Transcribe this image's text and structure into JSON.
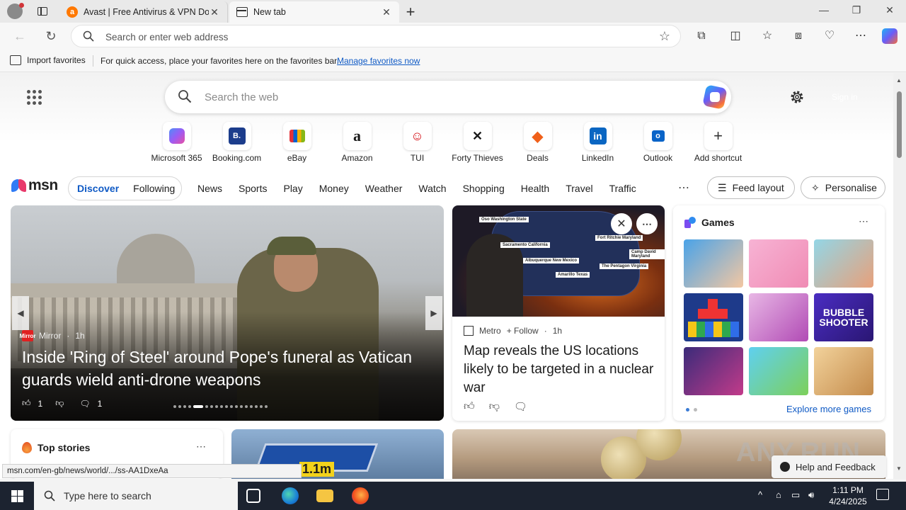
{
  "tabs": [
    {
      "title": "Avast | Free Antivirus & VPN Dow",
      "icon": "avast-icon"
    },
    {
      "title": "New tab",
      "icon": "newtab-icon"
    }
  ],
  "address": {
    "placeholder": "Search or enter web address"
  },
  "favorites_bar": {
    "import_label": "Import favorites",
    "message": "For quick access, place your favorites here on the favorites bar.",
    "link": "Manage favorites now"
  },
  "search": {
    "placeholder": "Search the web"
  },
  "signin": "Sign in",
  "shortcuts": [
    {
      "label": "Microsoft 365",
      "glyph": "",
      "color": "#7a5cf5"
    },
    {
      "label": "Booking.com",
      "glyph": "B.",
      "color": "#1c3d8c"
    },
    {
      "label": "eBay",
      "glyph": "",
      "color": "#e53238"
    },
    {
      "label": "Amazon",
      "glyph": "a",
      "color": "#111111"
    },
    {
      "label": "TUI",
      "glyph": "☺",
      "color": "#d40e14"
    },
    {
      "label": "Forty Thieves",
      "glyph": "✕",
      "color": "#111111"
    },
    {
      "label": "Deals",
      "glyph": "◆",
      "color": "#f0601a"
    },
    {
      "label": "LinkedIn",
      "glyph": "in",
      "color": "#0a66c2"
    },
    {
      "label": "Outlook",
      "glyph": "o",
      "color": "#0a64c8"
    },
    {
      "label": "Add shortcut",
      "glyph": "+",
      "color": "#333333"
    }
  ],
  "msn": {
    "logo": "msn",
    "feed_tabs": [
      "Discover",
      "Following"
    ],
    "categories": [
      "News",
      "Sports",
      "Play",
      "Money",
      "Weather",
      "Watch",
      "Shopping",
      "Health",
      "Travel",
      "Traffic"
    ],
    "feed_layout": "Feed layout",
    "personalise": "Personalise"
  },
  "hero": {
    "source": "Mirror",
    "source_badge": "Mirror",
    "age": "1h",
    "title": "Inside 'Ring of Steel' around Pope's funeral as Vatican guards wield anti-drone weapons",
    "likes": "1",
    "comments": "1"
  },
  "card2": {
    "source": "Metro",
    "follow": "Follow",
    "age": "1h",
    "title": "Map reveals the US locations likely to be targeted in a nuclear war",
    "map_labels": [
      "Oso Washington State",
      "Sacramento California",
      "Albuquerque New Mexico",
      "Amarillo Texas",
      "Fort Ritchie Maryland",
      "Camp David Maryland",
      "The Pentagon Virginia"
    ]
  },
  "games": {
    "title": "Games",
    "tile_text": "BUBBLE SHOOTER",
    "explore": "Explore more games"
  },
  "top_stories": {
    "title": "Top stories"
  },
  "card4_tag": "1.1m",
  "status_url": "msn.com/en-gb/news/world/.../ss-AA1DxeAa",
  "help": "Help and Feedback",
  "watermark": "ANY.RUN",
  "taskbar": {
    "search_placeholder": "Type here to search",
    "time": "1:11 PM",
    "date": "4/24/2025"
  }
}
